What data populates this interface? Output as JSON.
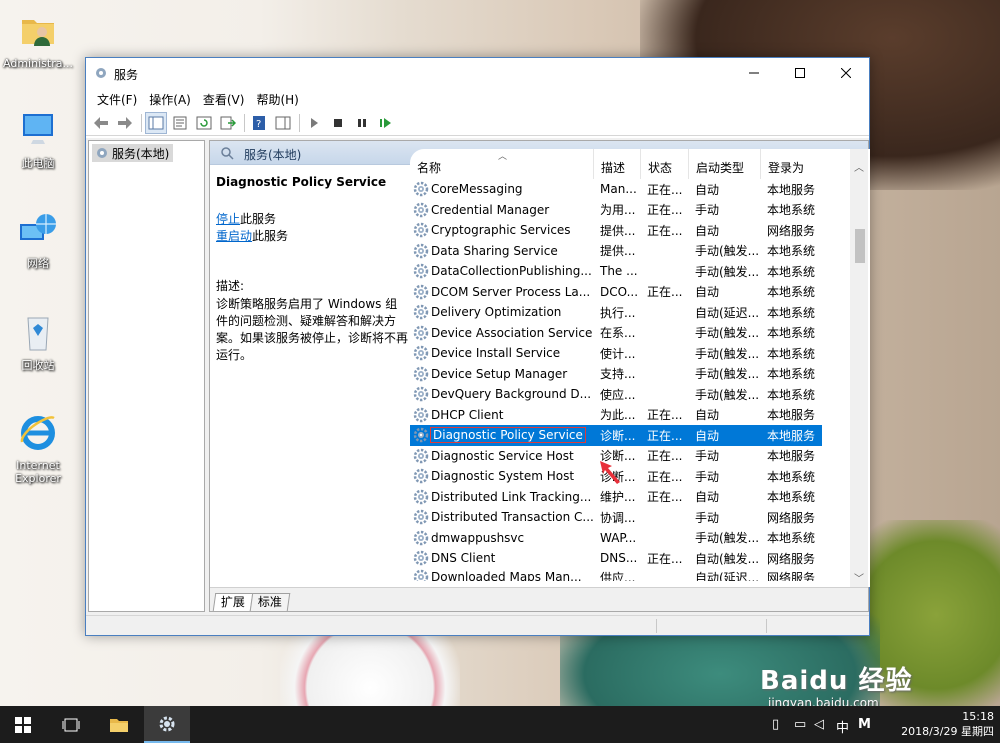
{
  "desktop": {
    "icons": [
      {
        "label": "Administra..."
      },
      {
        "label": "此电脑"
      },
      {
        "label": "网络"
      },
      {
        "label": "回收站"
      },
      {
        "label": "Internet Explorer"
      }
    ],
    "watermark": {
      "logo": "Baidu 经验",
      "url": "jingyan.baidu.com"
    }
  },
  "window": {
    "title": "服务",
    "menu": [
      "文件(F)",
      "操作(A)",
      "查看(V)",
      "帮助(H)"
    ],
    "tree_item": "服务(本地)",
    "header_label": "服务(本地)",
    "desc": {
      "title": "Diagnostic Policy Service",
      "stop_link": "停止",
      "stop_suffix": "此服务",
      "restart_link": "重启动",
      "restart_suffix": "此服务",
      "label": "描述:",
      "text": "诊断策略服务启用了 Windows 组件的问题检测、疑难解答和解决方案。如果该服务被停止，诊断将不再运行。"
    },
    "columns": [
      "名称",
      "描述",
      "状态",
      "启动类型",
      "登录为"
    ],
    "rows": [
      {
        "name": "CoreMessaging",
        "desc": "Man...",
        "status": "正在...",
        "startup": "自动",
        "logon": "本地服务"
      },
      {
        "name": "Credential Manager",
        "desc": "为用...",
        "status": "正在...",
        "startup": "手动",
        "logon": "本地系统"
      },
      {
        "name": "Cryptographic Services",
        "desc": "提供...",
        "status": "正在...",
        "startup": "自动",
        "logon": "网络服务"
      },
      {
        "name": "Data Sharing Service",
        "desc": "提供...",
        "status": "",
        "startup": "手动(触发...",
        "logon": "本地系统"
      },
      {
        "name": "DataCollectionPublishing...",
        "desc": "The ...",
        "status": "",
        "startup": "手动(触发...",
        "logon": "本地系统"
      },
      {
        "name": "DCOM Server Process La...",
        "desc": "DCO...",
        "status": "正在...",
        "startup": "自动",
        "logon": "本地系统"
      },
      {
        "name": "Delivery Optimization",
        "desc": "执行...",
        "status": "",
        "startup": "自动(延迟...",
        "logon": "本地系统"
      },
      {
        "name": "Device Association Service",
        "desc": "在系...",
        "status": "",
        "startup": "手动(触发...",
        "logon": "本地系统"
      },
      {
        "name": "Device Install Service",
        "desc": "使计...",
        "status": "",
        "startup": "手动(触发...",
        "logon": "本地系统"
      },
      {
        "name": "Device Setup Manager",
        "desc": "支持...",
        "status": "",
        "startup": "手动(触发...",
        "logon": "本地系统"
      },
      {
        "name": "DevQuery Background D...",
        "desc": "使应...",
        "status": "",
        "startup": "手动(触发...",
        "logon": "本地系统"
      },
      {
        "name": "DHCP Client",
        "desc": "为此...",
        "status": "正在...",
        "startup": "自动",
        "logon": "本地服务"
      },
      {
        "name": "Diagnostic Policy Service",
        "desc": "诊断...",
        "status": "正在...",
        "startup": "自动",
        "logon": "本地服务"
      },
      {
        "name": "Diagnostic Service Host",
        "desc": "诊断...",
        "status": "正在...",
        "startup": "手动",
        "logon": "本地服务"
      },
      {
        "name": "Diagnostic System Host",
        "desc": "诊断...",
        "status": "正在...",
        "startup": "手动",
        "logon": "本地系统"
      },
      {
        "name": "Distributed Link Tracking...",
        "desc": "维护...",
        "status": "正在...",
        "startup": "自动",
        "logon": "本地系统"
      },
      {
        "name": "Distributed Transaction C...",
        "desc": "协调...",
        "status": "",
        "startup": "手动",
        "logon": "网络服务"
      },
      {
        "name": "dmwappushsvc",
        "desc": "WAP...",
        "status": "",
        "startup": "手动(触发...",
        "logon": "本地系统"
      },
      {
        "name": "DNS Client",
        "desc": "DNS...",
        "status": "正在...",
        "startup": "自动(触发...",
        "logon": "网络服务"
      },
      {
        "name": "Downloaded Maps Man...",
        "desc": "供应...",
        "status": "",
        "startup": "自动(延迟...",
        "logon": "网络服务"
      }
    ],
    "tabs": [
      "扩展",
      "标准"
    ]
  },
  "taskbar": {
    "time": "15:18",
    "date": "2018/3/29 星期四",
    "ime": "中",
    "ime_mode": "M"
  }
}
